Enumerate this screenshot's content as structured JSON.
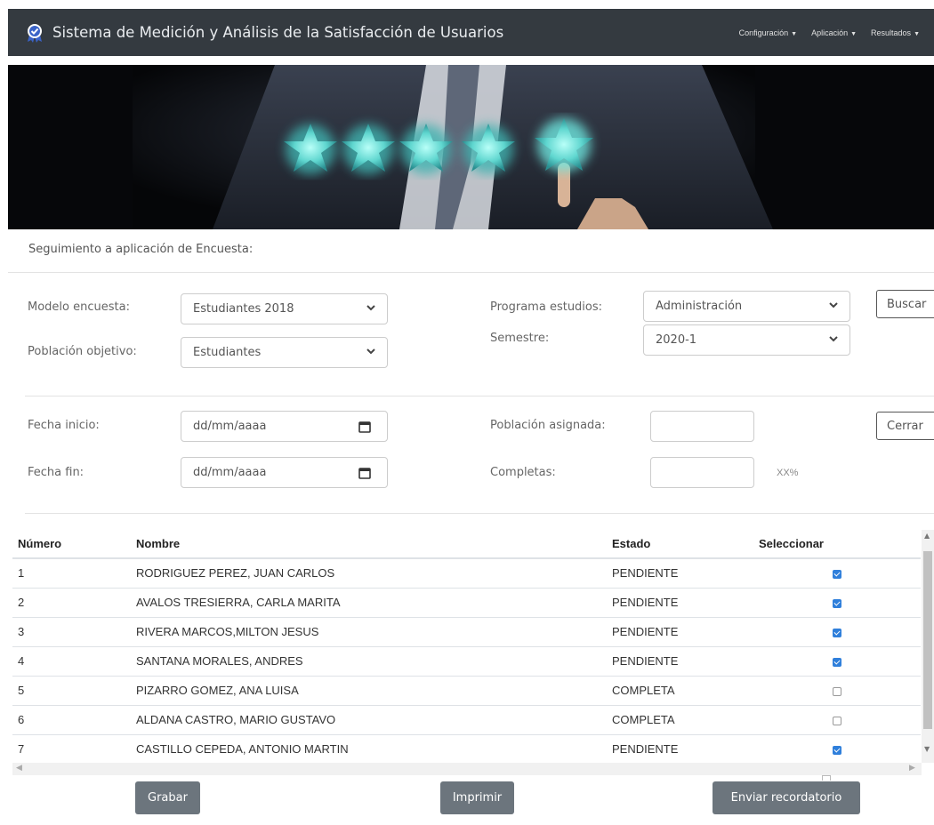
{
  "header": {
    "title": "Sistema de Medición y Análisis de la Satisfacción de Usuarios",
    "logo_icon": "badge-check-icon",
    "menu": [
      {
        "label": "Configuración"
      },
      {
        "label": "Aplicación"
      },
      {
        "label": "Resultados"
      }
    ],
    "bg_color": "#343a40"
  },
  "hero": {
    "image": "hand-touching-five-stars-banner"
  },
  "section": {
    "title": "Seguimiento a aplicación de Encuesta:"
  },
  "filters": {
    "modelo_label": "Modelo encuesta:",
    "modelo_value": "Estudiantes 2018",
    "poblacion_label": "Población objetivo:",
    "poblacion_value": "Estudiantes",
    "programa_label": "Programa estudios:",
    "programa_value": "Administración",
    "semestre_label": "Semestre:",
    "semestre_value": "2020-1",
    "buscar_label": "Buscar"
  },
  "details": {
    "fecha_inicio_label": "Fecha inicio:",
    "fecha_inicio_placeholder": "dd/mm/aaaa",
    "fecha_fin_label": "Fecha fin:",
    "fecha_fin_placeholder": "dd/mm/aaaa",
    "poblacion_asignada_label": "Población asignada:",
    "poblacion_asignada_value": "",
    "completas_label": "Completas:",
    "completas_value": "",
    "percent_text": "XX%",
    "cerrar_label": "Cerrar"
  },
  "table": {
    "headers": [
      "Número",
      "Nombre",
      "Estado",
      "Seleccionar"
    ],
    "rows": [
      {
        "numero": "1",
        "nombre": "RODRIGUEZ PEREZ, JUAN CARLOS",
        "estado": "PENDIENTE",
        "checked": true
      },
      {
        "numero": "2",
        "nombre": "AVALOS TRESIERRA, CARLA MARITA",
        "estado": "PENDIENTE",
        "checked": true
      },
      {
        "numero": "3",
        "nombre": "RIVERA MARCOS,MILTON JESUS",
        "estado": "PENDIENTE",
        "checked": true
      },
      {
        "numero": "4",
        "nombre": "SANTANA MORALES, ANDRES",
        "estado": "PENDIENTE",
        "checked": true
      },
      {
        "numero": "5",
        "nombre": "PIZARRO GOMEZ, ANA LUISA",
        "estado": "COMPLETA",
        "checked": false
      },
      {
        "numero": "6",
        "nombre": "ALDANA CASTRO, MARIO GUSTAVO",
        "estado": "COMPLETA",
        "checked": false
      },
      {
        "numero": "7",
        "nombre": "CASTILLO CEPEDA, ANTONIO MARTIN",
        "estado": "PENDIENTE",
        "checked": true
      }
    ]
  },
  "actions": {
    "grabar_label": "Grabar",
    "imprimir_label": "Imprimir",
    "recordatorio_label": "Enviar recordatorio"
  }
}
